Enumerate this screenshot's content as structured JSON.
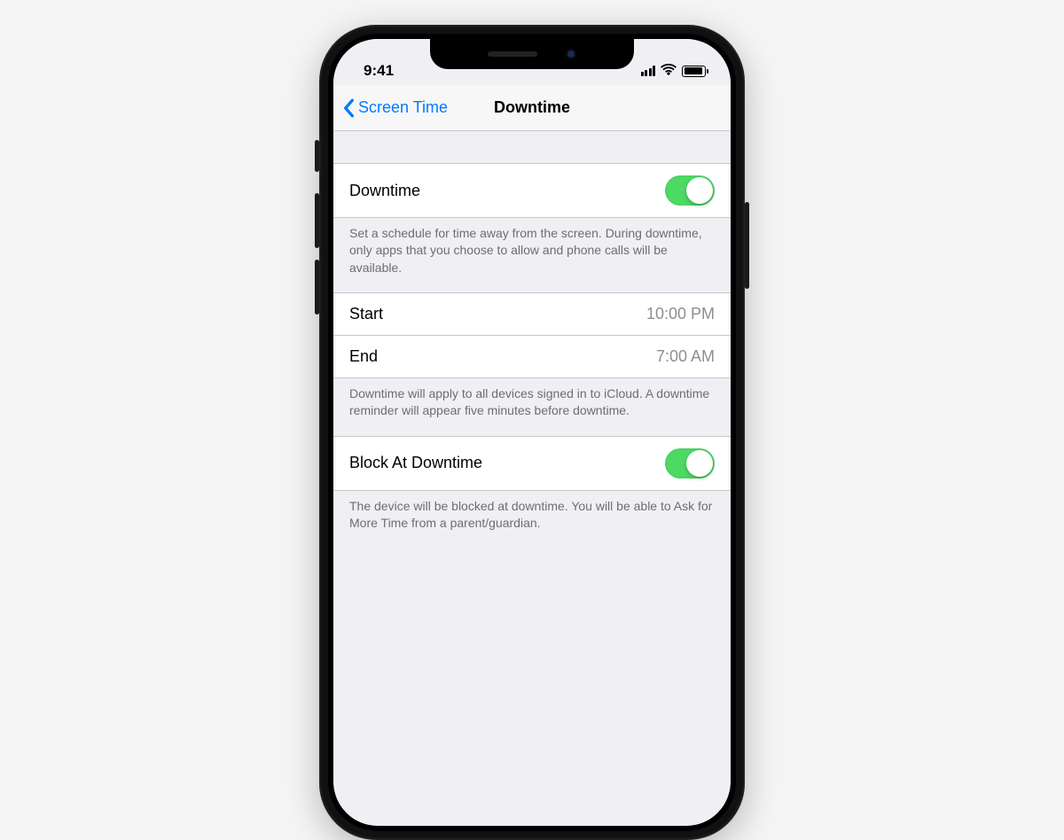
{
  "status": {
    "time": "9:41"
  },
  "nav": {
    "back": "Screen Time",
    "title": "Downtime"
  },
  "sections": {
    "downtime": {
      "label": "Downtime",
      "enabled": true,
      "footer": "Set a schedule for time away from the screen. During downtime, only apps that you choose to allow and phone calls will be available."
    },
    "schedule": {
      "start_label": "Start",
      "start_value": "10:00 PM",
      "end_label": "End",
      "end_value": "7:00 AM",
      "footer": "Downtime will apply to all devices signed in to iCloud. A downtime reminder will appear five minutes before downtime."
    },
    "block": {
      "label": "Block At Downtime",
      "enabled": true,
      "footer": "The device will be blocked at downtime. You will be able to Ask for More Time from a parent/guardian."
    }
  }
}
